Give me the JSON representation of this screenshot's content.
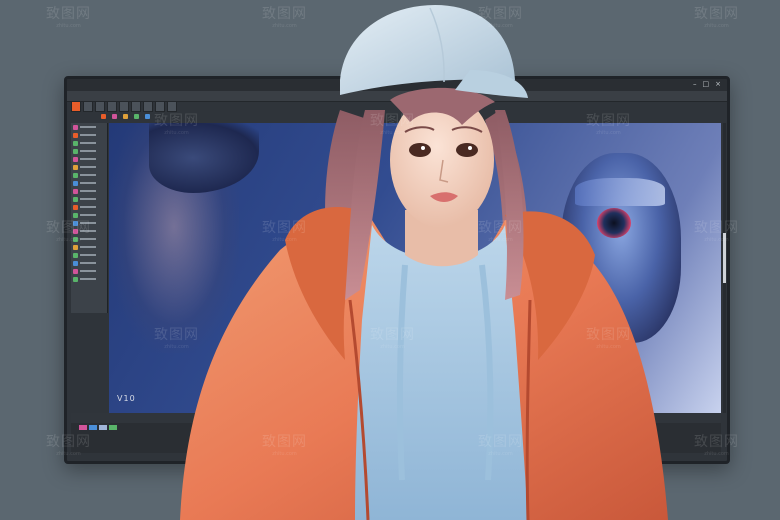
{
  "monitor": {
    "title": "",
    "tabs": [
      "",
      "",
      "",
      "",
      "",
      "",
      "",
      "",
      ""
    ],
    "canvas_label": "V10",
    "status_chips": [
      "",
      "",
      "",
      ""
    ]
  },
  "watermark": {
    "text": "致图网",
    "sub": "zhitu.com"
  },
  "colors": {
    "background": "#5b6770",
    "jacket": "#e97a55",
    "shirt": "#a9cbe3",
    "cap": "#cfe0ec",
    "hair": "#b97f86",
    "accent": "#e85d2a"
  }
}
